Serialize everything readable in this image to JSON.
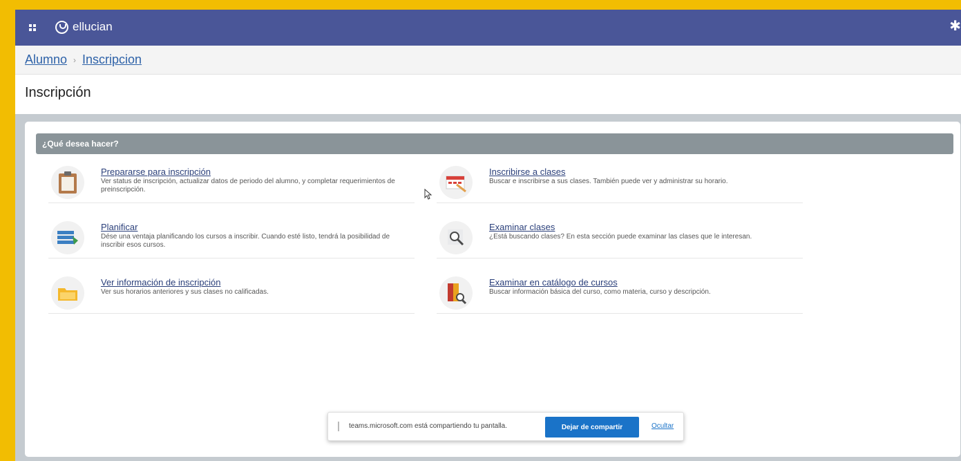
{
  "topbar": {
    "brand": "ellucian",
    "menu_icon": "grid-icon",
    "logo_icon": "ellucian-logo-icon",
    "settings_icon": "gear-icon",
    "color": "#4a5698"
  },
  "breadcrumb": {
    "items": [
      "Alumno",
      "Inscripcion"
    ],
    "separator_icon": "chevron-right-icon"
  },
  "page": {
    "title": "Inscripción"
  },
  "panel": {
    "header": "¿Qué desea hacer?"
  },
  "options": [
    {
      "title": "Prepararse para inscripción",
      "description": "Ver status de inscripción, actualizar datos de periodo del alumno, y completar requerimientos de preinscripción.",
      "icon": "clipboard-icon"
    },
    {
      "title": "Inscribirse a clases",
      "description": "Buscar e inscribirse a sus clases. También puede ver y administrar su horario.",
      "icon": "calendar-edit-icon"
    },
    {
      "title": "Planificar",
      "description": "Dése una ventaja planificando los cursos a inscribir. Cuando esté listo, tendrá la posibilidad de inscribir esos cursos.",
      "icon": "plan-list-icon"
    },
    {
      "title": "Examinar clases",
      "description": "¿Está buscando clases? En esta sección puede examinar las clases que le interesan.",
      "icon": "magnifier-icon"
    },
    {
      "title": "Ver información de inscripción",
      "description": "Ver sus horarios anteriores y sus clases no calificadas.",
      "icon": "folder-icon"
    },
    {
      "title": "Examinar en catálogo de cursos",
      "description": "Buscar información básica del curso, como materia, curso y descripción.",
      "icon": "book-search-icon"
    }
  ],
  "share_bar": {
    "message": "teams.microsoft.com está compartiendo tu pantalla.",
    "stop_label": "Dejar de compartir",
    "hide_label": "Ocultar"
  },
  "colors": {
    "frame": "#f2bd02",
    "link": "#2e62a8",
    "panel_header": "#8a9499",
    "share_button": "#1a73c8"
  }
}
